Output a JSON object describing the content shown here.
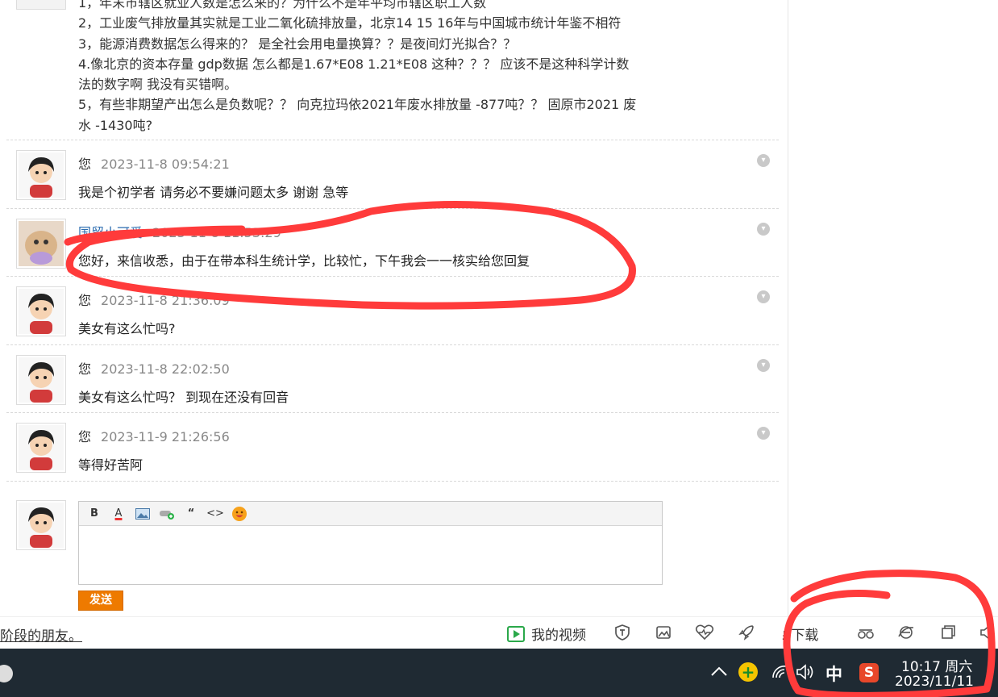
{
  "intro": {
    "lines": [
      "1，年末市辖区就业人数是怎么来的？为什么不是年平均市辖区职工人数",
      "2，工业废气排放量其实就是工业二氧化硫排放量，北京14 15 16年与中国城市统计年鉴不相符",
      "3，能源消费数据怎么得来的？ 是全社会用电量换算？？是夜间灯光拟合？？",
      "4.像北京的资本存量   gdp数据  怎么都是1.67*E08   1.21*E08  这种？？？   应该不是这种科学计数",
      "法的数字啊 我没有买错啊。",
      "5，有些非期望产出怎么是负数呢？？  向克拉玛依2021年废水排放量  -877吨？？  固原市2021 废",
      "水  -1430吨?"
    ]
  },
  "messages": [
    {
      "author": "您",
      "time": "2023-11-8 09:54:21",
      "text": "我是个初学者   请务必不要嫌问题太多   谢谢 急等"
    },
    {
      "author": "国贸小可爱",
      "time": "2023-11-8 11:53:29",
      "text": "您好，来信收悉，由于在带本科生统计学，比较忙，下午我会一一核实给您回复"
    },
    {
      "author": "您",
      "time": "2023-11-8 21:36:09",
      "text": "美女有这么忙吗?"
    },
    {
      "author": "您",
      "time": "2023-11-8 22:02:50",
      "text": "美女有这么忙吗？  到现在还没有回音"
    },
    {
      "author": "您",
      "time": "2023-11-9 21:26:56",
      "text": "等得好苦阿"
    }
  ],
  "editor": {
    "toolbar": {
      "bold": "B",
      "color": "A",
      "quote": "“",
      "code": "<>"
    },
    "send_label": "发送"
  },
  "bottombar": {
    "link_text": "阶段的朋友。",
    "video_label": "我的视频",
    "download_label": "下载"
  },
  "taskbar": {
    "ime": "中",
    "sogou": "S",
    "time": "10:17 周六",
    "date": "2023/11/11"
  },
  "colors": {
    "annotation": "#ff3b3b",
    "send_button": "#ee7a00",
    "taskbar": "#1f2a33",
    "link_author": "#2b6cb0"
  },
  "icons": [
    "play-icon",
    "shield-icon",
    "image-icon",
    "heartbeat-icon",
    "rocket-icon",
    "download-icon",
    "glasses-icon",
    "ie-icon",
    "window-icon",
    "speaker-icon",
    "chevron-up-icon",
    "plus-icon",
    "wifi-icon",
    "volume-icon"
  ]
}
